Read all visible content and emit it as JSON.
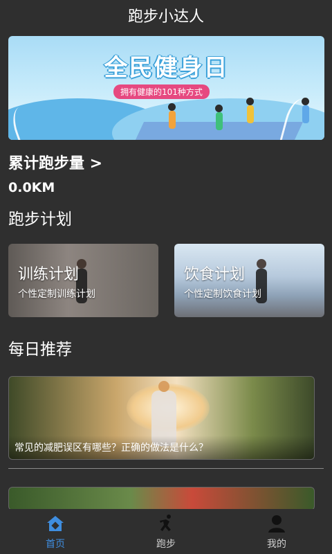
{
  "app": {
    "title": "跑步小达人"
  },
  "banner": {
    "title": "全民健身日",
    "subtitle": "拥有健康的101种方式"
  },
  "stats": {
    "total_label": "累计跑步量 >",
    "total_value": "0.0KM"
  },
  "plan": {
    "section_title": "跑步计划",
    "cards": [
      {
        "name": "训练计划",
        "desc": "个性定制训练计划"
      },
      {
        "name": "饮食计划",
        "desc": "个性定制饮食计划"
      }
    ]
  },
  "daily": {
    "section_title": "每日推荐",
    "items": [
      {
        "caption": "常见的减肥误区有哪些？正确的做法是什么？"
      }
    ]
  },
  "tabbar": {
    "items": [
      {
        "label": "首页",
        "icon": "home-icon",
        "active": true
      },
      {
        "label": "跑步",
        "icon": "runner-icon",
        "active": false
      },
      {
        "label": "我的",
        "icon": "user-icon",
        "active": false
      }
    ],
    "active_color": "#3f8ee0"
  }
}
